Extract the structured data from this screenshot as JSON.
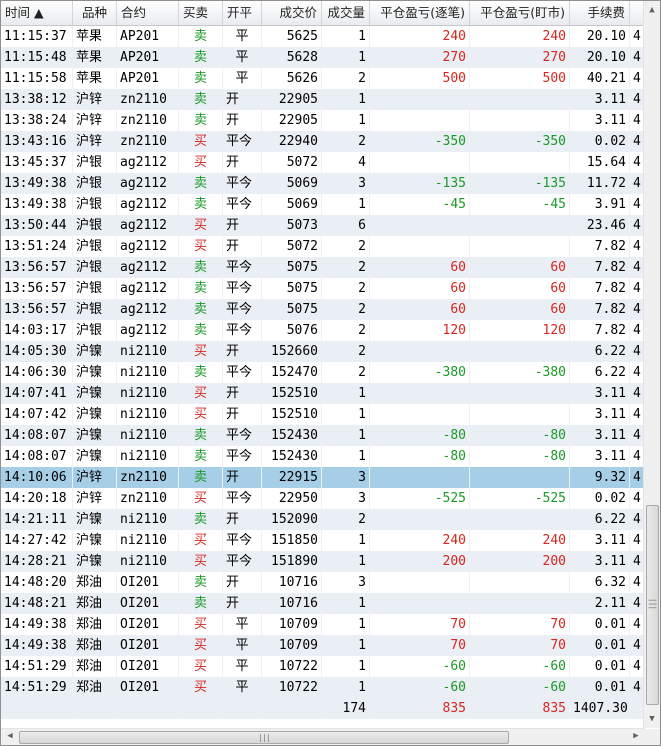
{
  "columns": [
    "时间 ▲",
    "品种",
    "合约",
    "买卖",
    "开平",
    "成交价",
    "成交量",
    "平仓盈亏(逐笔)",
    "平仓盈亏(盯市)",
    "手续费",
    ""
  ],
  "rows": [
    {
      "time": "11:15:37",
      "product": "苹果",
      "contract": "AP201",
      "side": "卖",
      "oc": "平",
      "price": "5625",
      "qty": "1",
      "pl_trade": "240",
      "pl_mtm": "240",
      "fee": "20.10",
      "extra": "4"
    },
    {
      "time": "11:15:48",
      "product": "苹果",
      "contract": "AP201",
      "side": "卖",
      "oc": "平",
      "price": "5628",
      "qty": "1",
      "pl_trade": "270",
      "pl_mtm": "270",
      "fee": "20.10",
      "extra": "4"
    },
    {
      "time": "11:15:58",
      "product": "苹果",
      "contract": "AP201",
      "side": "卖",
      "oc": "平",
      "price": "5626",
      "qty": "2",
      "pl_trade": "500",
      "pl_mtm": "500",
      "fee": "40.21",
      "extra": "4"
    },
    {
      "time": "13:38:12",
      "product": "沪锌",
      "contract": "zn2110",
      "side": "卖",
      "oc": "开",
      "price": "22905",
      "qty": "1",
      "pl_trade": "",
      "pl_mtm": "",
      "fee": "3.11",
      "extra": "4"
    },
    {
      "time": "13:38:24",
      "product": "沪锌",
      "contract": "zn2110",
      "side": "卖",
      "oc": "开",
      "price": "22905",
      "qty": "1",
      "pl_trade": "",
      "pl_mtm": "",
      "fee": "3.11",
      "extra": "4"
    },
    {
      "time": "13:43:16",
      "product": "沪锌",
      "contract": "zn2110",
      "side": "买",
      "oc": "平今",
      "price": "22940",
      "qty": "2",
      "pl_trade": "-350",
      "pl_mtm": "-350",
      "fee": "0.02",
      "extra": "4"
    },
    {
      "time": "13:45:37",
      "product": "沪银",
      "contract": "ag2112",
      "side": "买",
      "oc": "开",
      "price": "5072",
      "qty": "4",
      "pl_trade": "",
      "pl_mtm": "",
      "fee": "15.64",
      "extra": "4"
    },
    {
      "time": "13:49:38",
      "product": "沪银",
      "contract": "ag2112",
      "side": "卖",
      "oc": "平今",
      "price": "5069",
      "qty": "3",
      "pl_trade": "-135",
      "pl_mtm": "-135",
      "fee": "11.72",
      "extra": "4"
    },
    {
      "time": "13:49:38",
      "product": "沪银",
      "contract": "ag2112",
      "side": "卖",
      "oc": "平今",
      "price": "5069",
      "qty": "1",
      "pl_trade": "-45",
      "pl_mtm": "-45",
      "fee": "3.91",
      "extra": "4"
    },
    {
      "time": "13:50:44",
      "product": "沪银",
      "contract": "ag2112",
      "side": "买",
      "oc": "开",
      "price": "5073",
      "qty": "6",
      "pl_trade": "",
      "pl_mtm": "",
      "fee": "23.46",
      "extra": "4"
    },
    {
      "time": "13:51:24",
      "product": "沪银",
      "contract": "ag2112",
      "side": "买",
      "oc": "开",
      "price": "5072",
      "qty": "2",
      "pl_trade": "",
      "pl_mtm": "",
      "fee": "7.82",
      "extra": "4"
    },
    {
      "time": "13:56:57",
      "product": "沪银",
      "contract": "ag2112",
      "side": "卖",
      "oc": "平今",
      "price": "5075",
      "qty": "2",
      "pl_trade": "60",
      "pl_mtm": "60",
      "fee": "7.82",
      "extra": "4"
    },
    {
      "time": "13:56:57",
      "product": "沪银",
      "contract": "ag2112",
      "side": "卖",
      "oc": "平今",
      "price": "5075",
      "qty": "2",
      "pl_trade": "60",
      "pl_mtm": "60",
      "fee": "7.82",
      "extra": "4"
    },
    {
      "time": "13:56:57",
      "product": "沪银",
      "contract": "ag2112",
      "side": "卖",
      "oc": "平今",
      "price": "5075",
      "qty": "2",
      "pl_trade": "60",
      "pl_mtm": "60",
      "fee": "7.82",
      "extra": "4"
    },
    {
      "time": "14:03:17",
      "product": "沪银",
      "contract": "ag2112",
      "side": "卖",
      "oc": "平今",
      "price": "5076",
      "qty": "2",
      "pl_trade": "120",
      "pl_mtm": "120",
      "fee": "7.82",
      "extra": "4"
    },
    {
      "time": "14:05:30",
      "product": "沪镍",
      "contract": "ni2110",
      "side": "买",
      "oc": "开",
      "price": "152660",
      "qty": "2",
      "pl_trade": "",
      "pl_mtm": "",
      "fee": "6.22",
      "extra": "4"
    },
    {
      "time": "14:06:30",
      "product": "沪镍",
      "contract": "ni2110",
      "side": "卖",
      "oc": "平今",
      "price": "152470",
      "qty": "2",
      "pl_trade": "-380",
      "pl_mtm": "-380",
      "fee": "6.22",
      "extra": "4"
    },
    {
      "time": "14:07:41",
      "product": "沪镍",
      "contract": "ni2110",
      "side": "买",
      "oc": "开",
      "price": "152510",
      "qty": "1",
      "pl_trade": "",
      "pl_mtm": "",
      "fee": "3.11",
      "extra": "4"
    },
    {
      "time": "14:07:42",
      "product": "沪镍",
      "contract": "ni2110",
      "side": "买",
      "oc": "开",
      "price": "152510",
      "qty": "1",
      "pl_trade": "",
      "pl_mtm": "",
      "fee": "3.11",
      "extra": "4"
    },
    {
      "time": "14:08:07",
      "product": "沪镍",
      "contract": "ni2110",
      "side": "卖",
      "oc": "平今",
      "price": "152430",
      "qty": "1",
      "pl_trade": "-80",
      "pl_mtm": "-80",
      "fee": "3.11",
      "extra": "4"
    },
    {
      "time": "14:08:07",
      "product": "沪镍",
      "contract": "ni2110",
      "side": "卖",
      "oc": "平今",
      "price": "152430",
      "qty": "1",
      "pl_trade": "-80",
      "pl_mtm": "-80",
      "fee": "3.11",
      "extra": "4"
    },
    {
      "time": "14:10:06",
      "product": "沪锌",
      "contract": "zn2110",
      "side": "卖",
      "oc": "开",
      "price": "22915",
      "qty": "3",
      "pl_trade": "",
      "pl_mtm": "",
      "fee": "9.32",
      "extra": "4",
      "selected": true
    },
    {
      "time": "14:20:18",
      "product": "沪锌",
      "contract": "zn2110",
      "side": "买",
      "oc": "平今",
      "price": "22950",
      "qty": "3",
      "pl_trade": "-525",
      "pl_mtm": "-525",
      "fee": "0.02",
      "extra": "4"
    },
    {
      "time": "14:21:11",
      "product": "沪镍",
      "contract": "ni2110",
      "side": "卖",
      "oc": "开",
      "price": "152090",
      "qty": "2",
      "pl_trade": "",
      "pl_mtm": "",
      "fee": "6.22",
      "extra": "4"
    },
    {
      "time": "14:27:42",
      "product": "沪镍",
      "contract": "ni2110",
      "side": "买",
      "oc": "平今",
      "price": "151850",
      "qty": "1",
      "pl_trade": "240",
      "pl_mtm": "240",
      "fee": "3.11",
      "extra": "4"
    },
    {
      "time": "14:28:21",
      "product": "沪镍",
      "contract": "ni2110",
      "side": "买",
      "oc": "平今",
      "price": "151890",
      "qty": "1",
      "pl_trade": "200",
      "pl_mtm": "200",
      "fee": "3.11",
      "extra": "4"
    },
    {
      "time": "14:48:20",
      "product": "郑油",
      "contract": "OI201",
      "side": "卖",
      "oc": "开",
      "price": "10716",
      "qty": "3",
      "pl_trade": "",
      "pl_mtm": "",
      "fee": "6.32",
      "extra": "4"
    },
    {
      "time": "14:48:21",
      "product": "郑油",
      "contract": "OI201",
      "side": "卖",
      "oc": "开",
      "price": "10716",
      "qty": "1",
      "pl_trade": "",
      "pl_mtm": "",
      "fee": "2.11",
      "extra": "4"
    },
    {
      "time": "14:49:38",
      "product": "郑油",
      "contract": "OI201",
      "side": "买",
      "oc": "平",
      "price": "10709",
      "qty": "1",
      "pl_trade": "70",
      "pl_mtm": "70",
      "fee": "0.01",
      "extra": "4"
    },
    {
      "time": "14:49:38",
      "product": "郑油",
      "contract": "OI201",
      "side": "买",
      "oc": "平",
      "price": "10709",
      "qty": "1",
      "pl_trade": "70",
      "pl_mtm": "70",
      "fee": "0.01",
      "extra": "4"
    },
    {
      "time": "14:51:29",
      "product": "郑油",
      "contract": "OI201",
      "side": "买",
      "oc": "平",
      "price": "10722",
      "qty": "1",
      "pl_trade": "-60",
      "pl_mtm": "-60",
      "fee": "0.01",
      "extra": "4"
    },
    {
      "time": "14:51:29",
      "product": "郑油",
      "contract": "OI201",
      "side": "买",
      "oc": "平",
      "price": "10722",
      "qty": "1",
      "pl_trade": "-60",
      "pl_mtm": "-60",
      "fee": "0.01",
      "extra": "4"
    }
  ],
  "totals": {
    "qty": "174",
    "pl_trade": "835",
    "pl_mtm": "835",
    "fee": "1407.30"
  },
  "colors": {
    "buy": "#d8261f",
    "sell": "#1a9a26",
    "selected_row": "#a6cfe7",
    "alt_row": "#eaeef5"
  },
  "scrollbars": {
    "vertical_arrow_up": "▲",
    "vertical_arrow_down": "▼",
    "horizontal_arrow_left": "◀",
    "horizontal_arrow_right": "▶",
    "grip": "|||"
  }
}
